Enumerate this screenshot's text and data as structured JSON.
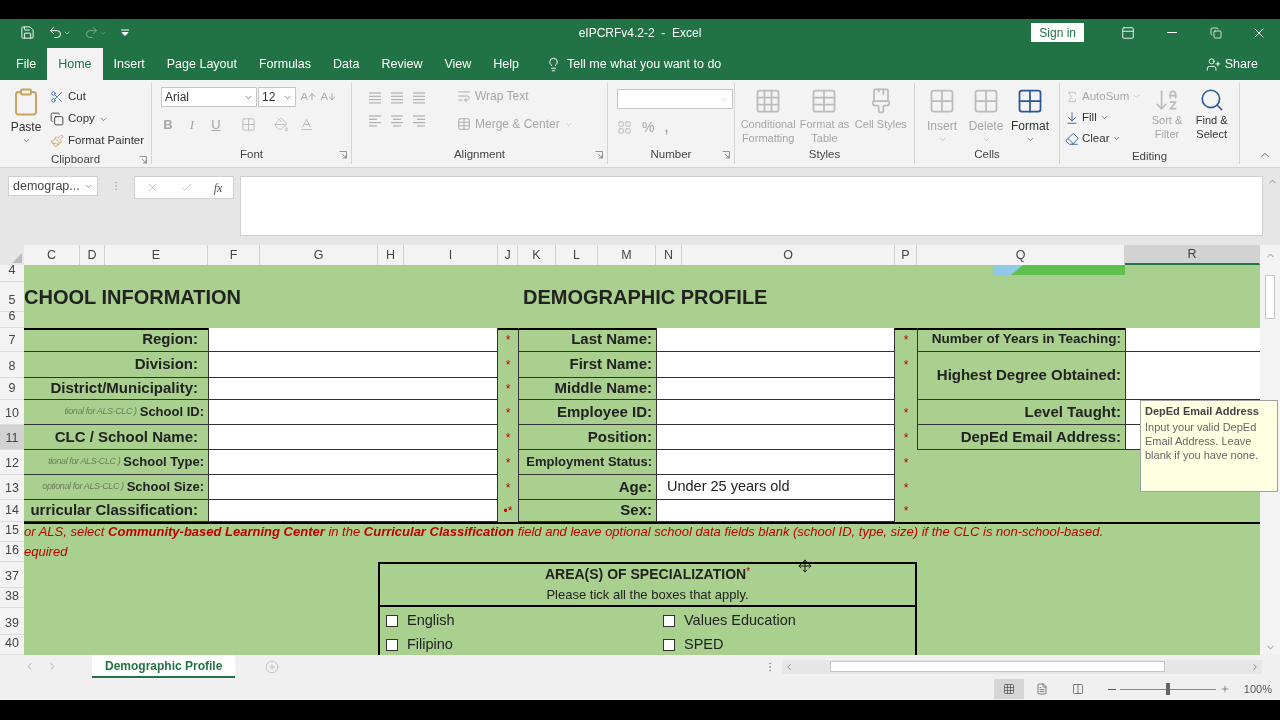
{
  "title_bar": {
    "title": "eIPCRFv4.2-2  -  Excel",
    "sign_in": "Sign in",
    "quick_access": [
      {
        "kind": "save",
        "disabled": false
      },
      {
        "kind": "undo",
        "disabled": false
      },
      {
        "kind": "redo",
        "disabled": true
      },
      {
        "kind": "customize",
        "disabled": false
      }
    ]
  },
  "menu_tabs": [
    {
      "label": "File",
      "selected": false
    },
    {
      "label": "Home",
      "selected": true
    },
    {
      "label": "Insert",
      "selected": false
    },
    {
      "label": "Page Layout",
      "selected": false
    },
    {
      "label": "Formulas",
      "selected": false
    },
    {
      "label": "Data",
      "selected": false
    },
    {
      "label": "Review",
      "selected": false
    },
    {
      "label": "View",
      "selected": false
    },
    {
      "label": "Help",
      "selected": false
    }
  ],
  "tell_me": "Tell me what you want to do",
  "share": "Share",
  "ribbon_groups": [
    {
      "kind": "clipboard",
      "name": "Clipboard",
      "paste": "Paste",
      "cut": "Cut",
      "copy": "Copy",
      "format_painter": "Format Painter"
    },
    {
      "kind": "font",
      "name": "Font",
      "font_name": "Arial",
      "font_size": "12",
      "bold": "B",
      "italic": "I",
      "underline": "U",
      "disabled": true
    },
    {
      "kind": "alignment",
      "name": "Alignment",
      "wrap_text": "Wrap Text",
      "merge_center": "Merge & Center",
      "disabled": true
    },
    {
      "kind": "number",
      "name": "Number",
      "percent": "%",
      "comma": ",",
      "disabled": true
    },
    {
      "kind": "styles",
      "name": "Styles",
      "buttons": [
        {
          "label": "Conditional Formatting",
          "disabled": true
        },
        {
          "label": "Format as Table",
          "disabled": true
        },
        {
          "label": "Cell Styles",
          "disabled": true
        }
      ]
    },
    {
      "kind": "cells",
      "name": "Cells",
      "buttons": [
        {
          "label": "Insert",
          "disabled": true
        },
        {
          "label": "Delete",
          "disabled": true
        },
        {
          "label": "Format",
          "disabled": false
        }
      ]
    },
    {
      "kind": "editing",
      "name": "Editing",
      "buttons": [
        {
          "label": "AutoSum",
          "disabled": true
        },
        {
          "label": "Fill",
          "disabled": false
        },
        {
          "label": "Clear",
          "disabled": false
        },
        {
          "label": "Sort & Filter",
          "disabled": true
        },
        {
          "label": "Find & Select",
          "disabled": false
        }
      ]
    }
  ],
  "formula_bar": {
    "name_box": "demograp...",
    "function_label": "fx"
  },
  "column_headers": [
    {
      "label": "C",
      "selected": false
    },
    {
      "label": "D",
      "selected": false
    },
    {
      "label": "E",
      "selected": false
    },
    {
      "label": "F",
      "selected": false
    },
    {
      "label": "G",
      "selected": false
    },
    {
      "label": "H",
      "selected": false
    },
    {
      "label": "I",
      "selected": false
    },
    {
      "label": "J",
      "selected": false
    },
    {
      "label": "K",
      "selected": false
    },
    {
      "label": "L",
      "selected": false
    },
    {
      "label": "M",
      "selected": false
    },
    {
      "label": "N",
      "selected": false
    },
    {
      "label": "O",
      "selected": false
    },
    {
      "label": "P",
      "selected": false
    },
    {
      "label": "Q",
      "selected": false
    },
    {
      "label": "R",
      "selected": true
    }
  ],
  "row_headers": [
    {
      "label": "4",
      "selected": false
    },
    {
      "label": "5",
      "selected": false
    },
    {
      "label": "6",
      "selected": false
    },
    {
      "label": "7",
      "selected": false
    },
    {
      "label": "8",
      "selected": false
    },
    {
      "label": "9",
      "selected": false
    },
    {
      "label": "10",
      "selected": false
    },
    {
      "label": "11",
      "selected": true
    },
    {
      "label": "12",
      "selected": false
    },
    {
      "label": "13",
      "selected": false
    },
    {
      "label": "14",
      "selected": false
    },
    {
      "label": "15",
      "selected": false
    },
    {
      "label": "16",
      "selected": false
    },
    {
      "label": "37",
      "selected": false
    },
    {
      "label": "38",
      "selected": false
    },
    {
      "label": "39",
      "selected": false
    },
    {
      "label": "40",
      "selected": false
    }
  ],
  "sheet": {
    "section_titles": [
      "CHOOL INFORMATION",
      "DEMOGRAPHIC PROFILE"
    ],
    "school_fields": [
      {
        "label": "Region:"
      },
      {
        "label": "Division:"
      },
      {
        "label": "District/Municipality:"
      },
      {
        "note": "tional for ALS-CLC )",
        "label": "School ID:"
      },
      {
        "label": "CLC / School Name:"
      },
      {
        "note": "tional for ALS-CLC )",
        "label": "School Type:"
      },
      {
        "note": "optional for ALS-CLC )",
        "label": "School Size:"
      },
      {
        "label": "urricular Classification:"
      }
    ],
    "school_stars": [
      "*",
      "*",
      "*",
      "*",
      "*",
      "*",
      "*",
      "•*"
    ],
    "profile_fields": [
      {
        "label": "Last Name:"
      },
      {
        "label": "First Name:"
      },
      {
        "label": "Middle Name:"
      },
      {
        "label": "Employee ID:"
      },
      {
        "label": "Position:"
      },
      {
        "label": "Employment Status:"
      },
      {
        "label": "Age:",
        "value": "Under 25 years old"
      },
      {
        "label": "Sex:"
      }
    ],
    "profile_stars": [
      "*",
      "*",
      "*",
      "*",
      "*",
      "*",
      "*"
    ],
    "teaching_fields": [
      {
        "label": "Number of Years in Teaching:"
      },
      {
        "label": "Highest Degree Obtained:"
      },
      {
        "label": "Level Taught:"
      },
      {
        "label": "DepEd Email Address:"
      }
    ],
    "notes": [
      "or ALS, select **Community-based Learning Center** in the **Curricular Classification** field and leave optional school data fields blank (school ID, type, size) if the CLC is non-school-based.",
      "equired"
    ],
    "specialization": {
      "title": "AREA(S) OF SPECIALIZATION",
      "required_mark": "*",
      "subtitle": "Please tick all the boxes that apply.",
      "options": [
        {
          "label": "English",
          "checked": false
        },
        {
          "label": "Values Education",
          "checked": false
        },
        {
          "label": "Filipino",
          "checked": false
        },
        {
          "label": "SPED",
          "checked": false
        }
      ]
    }
  },
  "tooltip": {
    "title": "DepEd Email Address",
    "body": "Input your valid DepEd Email Address. Leave blank if you have none."
  },
  "sheet_tabs": [
    {
      "label": "Demographic Profile",
      "selected": true
    }
  ],
  "status_bar": {
    "zoom_label": "100%",
    "zoom_slider": {
      "level": 0.5
    }
  }
}
